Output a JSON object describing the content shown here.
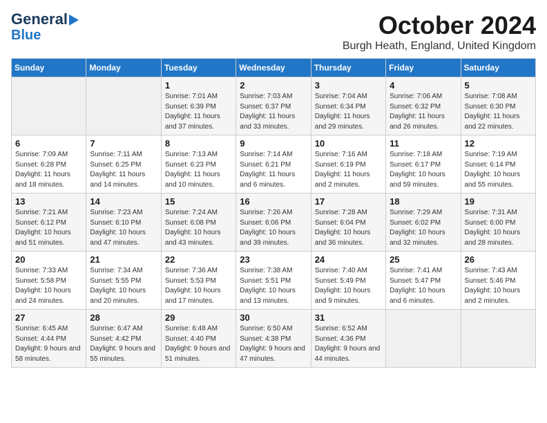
{
  "header": {
    "logo_line1": "General",
    "logo_line2": "Blue",
    "month_title": "October 2024",
    "subtitle": "Burgh Heath, England, United Kingdom"
  },
  "days_of_week": [
    "Sunday",
    "Monday",
    "Tuesday",
    "Wednesday",
    "Thursday",
    "Friday",
    "Saturday"
  ],
  "weeks": [
    [
      {
        "num": "",
        "info": ""
      },
      {
        "num": "",
        "info": ""
      },
      {
        "num": "1",
        "info": "Sunrise: 7:01 AM\nSunset: 6:39 PM\nDaylight: 11 hours and 37 minutes."
      },
      {
        "num": "2",
        "info": "Sunrise: 7:03 AM\nSunset: 6:37 PM\nDaylight: 11 hours and 33 minutes."
      },
      {
        "num": "3",
        "info": "Sunrise: 7:04 AM\nSunset: 6:34 PM\nDaylight: 11 hours and 29 minutes."
      },
      {
        "num": "4",
        "info": "Sunrise: 7:06 AM\nSunset: 6:32 PM\nDaylight: 11 hours and 26 minutes."
      },
      {
        "num": "5",
        "info": "Sunrise: 7:08 AM\nSunset: 6:30 PM\nDaylight: 11 hours and 22 minutes."
      }
    ],
    [
      {
        "num": "6",
        "info": "Sunrise: 7:09 AM\nSunset: 6:28 PM\nDaylight: 11 hours and 18 minutes."
      },
      {
        "num": "7",
        "info": "Sunrise: 7:11 AM\nSunset: 6:25 PM\nDaylight: 11 hours and 14 minutes."
      },
      {
        "num": "8",
        "info": "Sunrise: 7:13 AM\nSunset: 6:23 PM\nDaylight: 11 hours and 10 minutes."
      },
      {
        "num": "9",
        "info": "Sunrise: 7:14 AM\nSunset: 6:21 PM\nDaylight: 11 hours and 6 minutes."
      },
      {
        "num": "10",
        "info": "Sunrise: 7:16 AM\nSunset: 6:19 PM\nDaylight: 11 hours and 2 minutes."
      },
      {
        "num": "11",
        "info": "Sunrise: 7:18 AM\nSunset: 6:17 PM\nDaylight: 10 hours and 59 minutes."
      },
      {
        "num": "12",
        "info": "Sunrise: 7:19 AM\nSunset: 6:14 PM\nDaylight: 10 hours and 55 minutes."
      }
    ],
    [
      {
        "num": "13",
        "info": "Sunrise: 7:21 AM\nSunset: 6:12 PM\nDaylight: 10 hours and 51 minutes."
      },
      {
        "num": "14",
        "info": "Sunrise: 7:23 AM\nSunset: 6:10 PM\nDaylight: 10 hours and 47 minutes."
      },
      {
        "num": "15",
        "info": "Sunrise: 7:24 AM\nSunset: 6:08 PM\nDaylight: 10 hours and 43 minutes."
      },
      {
        "num": "16",
        "info": "Sunrise: 7:26 AM\nSunset: 6:06 PM\nDaylight: 10 hours and 39 minutes."
      },
      {
        "num": "17",
        "info": "Sunrise: 7:28 AM\nSunset: 6:04 PM\nDaylight: 10 hours and 36 minutes."
      },
      {
        "num": "18",
        "info": "Sunrise: 7:29 AM\nSunset: 6:02 PM\nDaylight: 10 hours and 32 minutes."
      },
      {
        "num": "19",
        "info": "Sunrise: 7:31 AM\nSunset: 6:00 PM\nDaylight: 10 hours and 28 minutes."
      }
    ],
    [
      {
        "num": "20",
        "info": "Sunrise: 7:33 AM\nSunset: 5:58 PM\nDaylight: 10 hours and 24 minutes."
      },
      {
        "num": "21",
        "info": "Sunrise: 7:34 AM\nSunset: 5:55 PM\nDaylight: 10 hours and 20 minutes."
      },
      {
        "num": "22",
        "info": "Sunrise: 7:36 AM\nSunset: 5:53 PM\nDaylight: 10 hours and 17 minutes."
      },
      {
        "num": "23",
        "info": "Sunrise: 7:38 AM\nSunset: 5:51 PM\nDaylight: 10 hours and 13 minutes."
      },
      {
        "num": "24",
        "info": "Sunrise: 7:40 AM\nSunset: 5:49 PM\nDaylight: 10 hours and 9 minutes."
      },
      {
        "num": "25",
        "info": "Sunrise: 7:41 AM\nSunset: 5:47 PM\nDaylight: 10 hours and 6 minutes."
      },
      {
        "num": "26",
        "info": "Sunrise: 7:43 AM\nSunset: 5:46 PM\nDaylight: 10 hours and 2 minutes."
      }
    ],
    [
      {
        "num": "27",
        "info": "Sunrise: 6:45 AM\nSunset: 4:44 PM\nDaylight: 9 hours and 58 minutes."
      },
      {
        "num": "28",
        "info": "Sunrise: 6:47 AM\nSunset: 4:42 PM\nDaylight: 9 hours and 55 minutes."
      },
      {
        "num": "29",
        "info": "Sunrise: 6:48 AM\nSunset: 4:40 PM\nDaylight: 9 hours and 51 minutes."
      },
      {
        "num": "30",
        "info": "Sunrise: 6:50 AM\nSunset: 4:38 PM\nDaylight: 9 hours and 47 minutes."
      },
      {
        "num": "31",
        "info": "Sunrise: 6:52 AM\nSunset: 4:36 PM\nDaylight: 9 hours and 44 minutes."
      },
      {
        "num": "",
        "info": ""
      },
      {
        "num": "",
        "info": ""
      }
    ]
  ]
}
